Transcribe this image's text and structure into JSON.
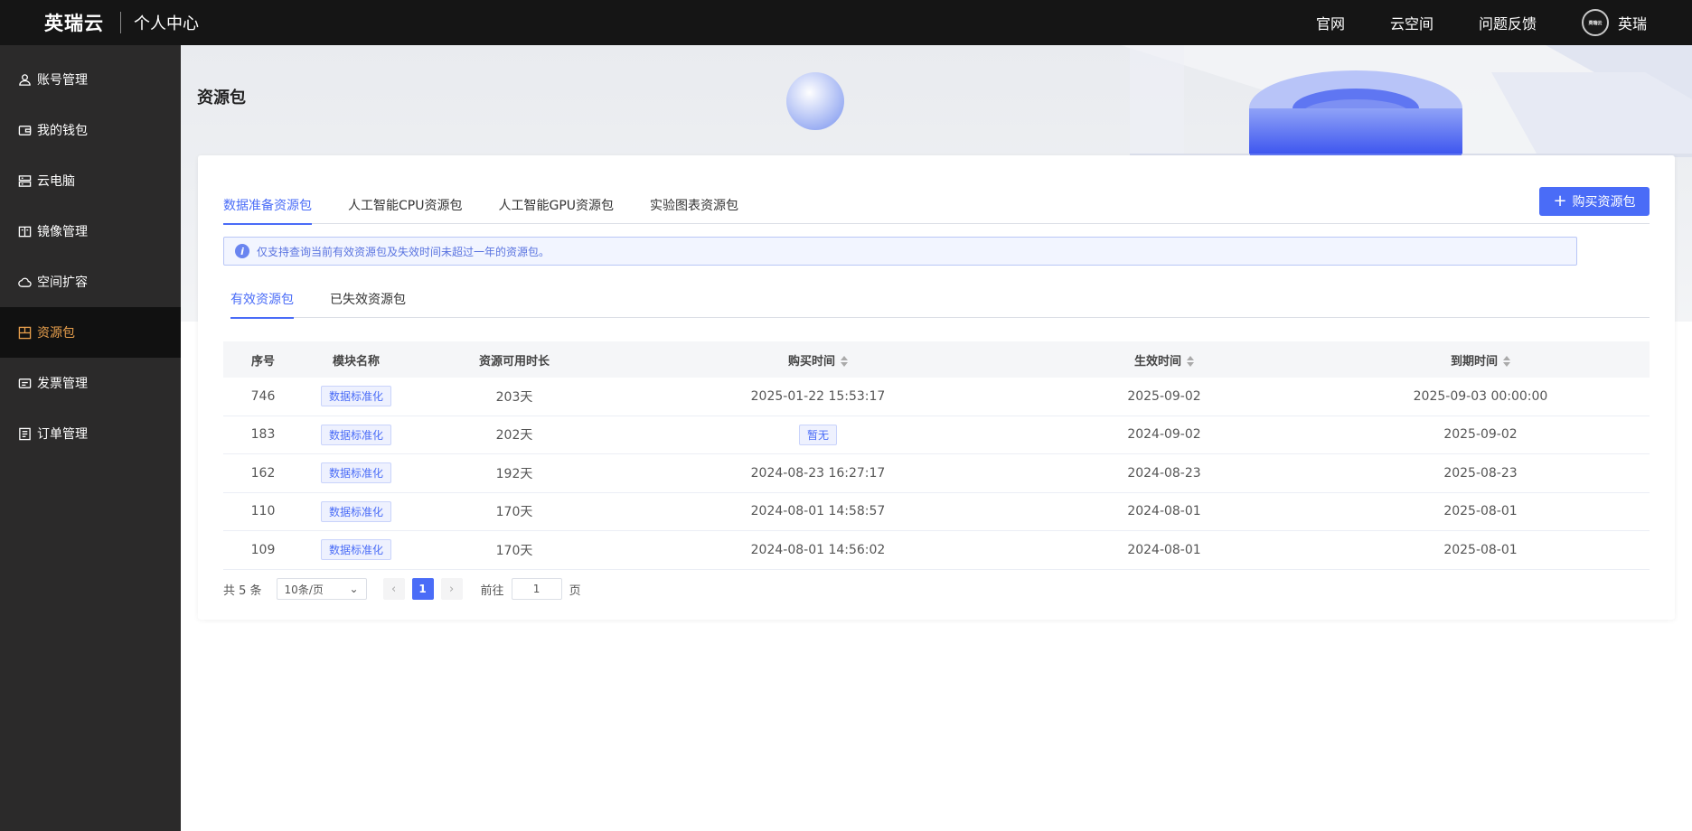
{
  "header": {
    "brand": "英瑞云",
    "subtitle": "个人中心",
    "nav": [
      "官网",
      "云空间",
      "问题反馈"
    ],
    "user_name": "英瑞",
    "avatar_logo": "英瑞云"
  },
  "sidebar": {
    "items": [
      {
        "label": "账号管理",
        "icon": "user-icon"
      },
      {
        "label": "我的钱包",
        "icon": "wallet-icon"
      },
      {
        "label": "云电脑",
        "icon": "server-icon"
      },
      {
        "label": "镜像管理",
        "icon": "image-icon"
      },
      {
        "label": "空间扩容",
        "icon": "cloud-icon"
      },
      {
        "label": "资源包",
        "icon": "package-icon",
        "active": true
      },
      {
        "label": "发票管理",
        "icon": "ticket-icon"
      },
      {
        "label": "订单管理",
        "icon": "order-icon"
      }
    ],
    "active_color": "#e9a04d"
  },
  "main": {
    "title": "资源包",
    "tabs": [
      "数据准备资源包",
      "人工智能CPU资源包",
      "人工智能GPU资源包",
      "实验图表资源包"
    ],
    "buy_button": "购买资源包",
    "notice": "仅支持查询当前有效资源包及失效时间未超过一年的资源包。",
    "subtabs": [
      "有效资源包",
      "已失效资源包"
    ],
    "accent": "#4a6cf7"
  },
  "table": {
    "headers": [
      "序号",
      "模块名称",
      "资源可用时长",
      "购买时间",
      "生效时间",
      "到期时间"
    ],
    "rows": [
      [
        "746",
        "数据标准化",
        "203天",
        "2025-01-22 15:53:17",
        "2025-09-02",
        "2025-09-03 00:00:00"
      ],
      [
        "183",
        "数据标准化",
        "202天",
        "暂无",
        "2024-09-02",
        "2025-09-02"
      ],
      [
        "162",
        "数据标准化",
        "192天",
        "2024-08-23 16:27:17",
        "2024-08-23",
        "2025-08-23"
      ],
      [
        "110",
        "数据标准化",
        "170天",
        "2024-08-01 14:58:57",
        "2024-08-01",
        "2025-08-01"
      ],
      [
        "109",
        "数据标准化",
        "170天",
        "2024-08-01 14:56:02",
        "2024-08-01",
        "2025-08-01"
      ]
    ]
  },
  "pagination": {
    "total": "共 5 条",
    "page_size": "10条/页",
    "current_page": "1",
    "goto_label": "前往",
    "goto_value": "1",
    "page_suffix": "页"
  }
}
